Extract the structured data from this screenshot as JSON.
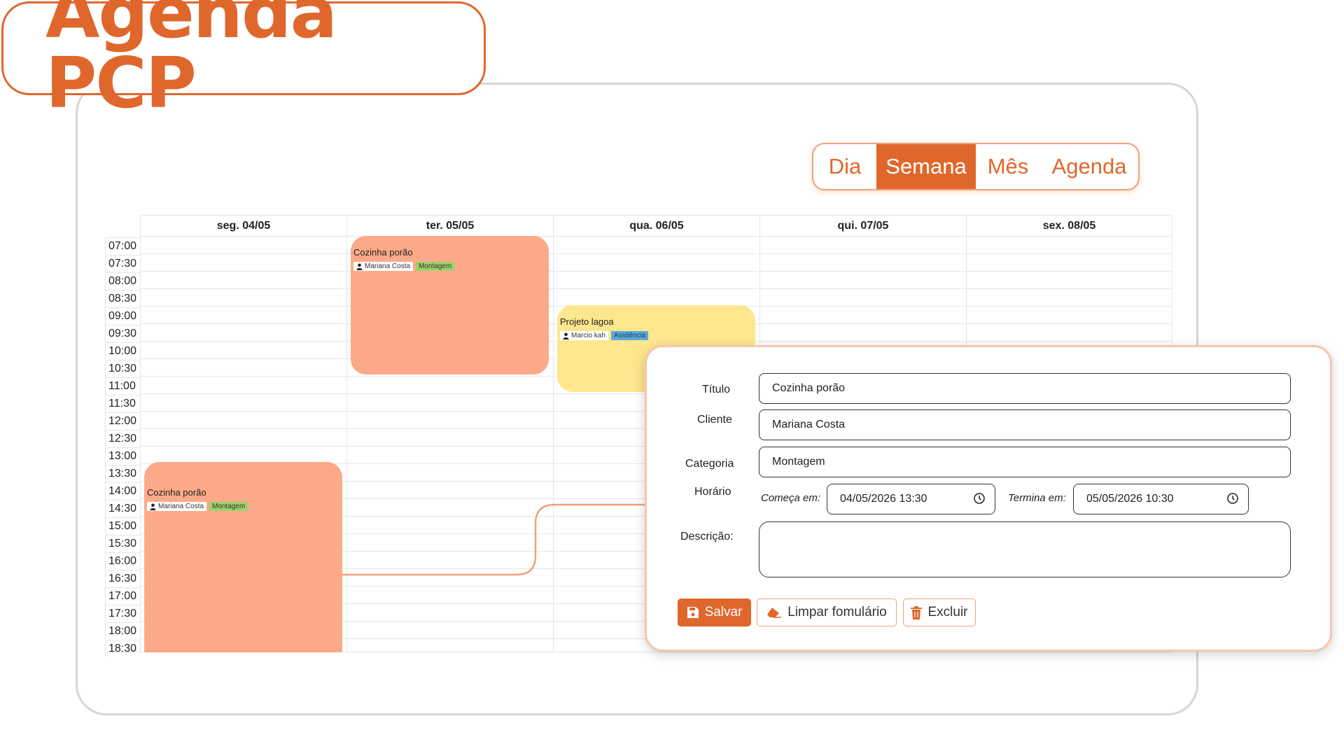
{
  "app": {
    "title": "Agenda PCP"
  },
  "views": {
    "day": "Dia",
    "week": "Semana",
    "month": "Mês",
    "agenda": "Agenda",
    "selected": "Semana"
  },
  "days": [
    "seg. 04/05",
    "ter. 05/05",
    "qua. 06/05",
    "qui. 07/05",
    "sex. 08/05"
  ],
  "times": [
    "07:00",
    "07:30",
    "08:00",
    "08:30",
    "09:00",
    "09:30",
    "10:00",
    "10:30",
    "11:00",
    "11:30",
    "12:00",
    "12:30",
    "13:00",
    "13:30",
    "14:00",
    "14:30",
    "15:00",
    "15:30",
    "16:00",
    "16:30",
    "17:00",
    "17:30",
    "18:00",
    "18:30"
  ],
  "events": [
    {
      "title": "Cozinha porão",
      "client": "Mariana Costa",
      "category": "Montagem",
      "color": "#fca98a",
      "category_color": "#9ed06a"
    },
    {
      "title": "Projeto lagoa",
      "client": "Marcio kah",
      "category": "Assitência",
      "color": "#fde68e",
      "category_color": "#5aaad8"
    },
    {
      "title": "Cozinha porão",
      "client": "Mariana Costa",
      "category": "Montagem",
      "color": "#fca98a",
      "category_color": "#9ed06a"
    }
  ],
  "form": {
    "title_label": "Título",
    "title_value": "Cozinha porão",
    "client_label": "Cliente",
    "client_value": "Mariana Costa",
    "category_label": "Categoria",
    "category_value": "Montagem",
    "time_label": "Horário",
    "start_label": "Começa em:",
    "start_value": "04/05/2026 13:30",
    "end_label": "Termina em:",
    "end_value": "05/05/2026 10:30",
    "description_label": "Descrição:",
    "description_value": "",
    "save_label": "Salvar",
    "clear_label": "Limpar fomulário",
    "delete_label": "Excluir"
  },
  "colors": {
    "accent": "#e0672c",
    "accent_light": "#f0a07a",
    "event_orange": "#fca98a",
    "event_yellow": "#fde68e"
  }
}
